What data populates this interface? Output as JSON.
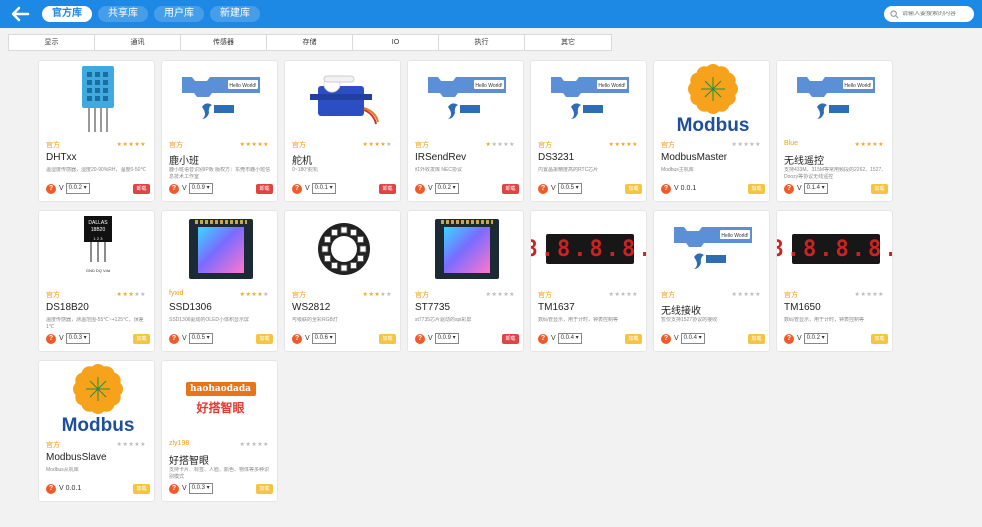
{
  "header": {
    "tabs": [
      "官方库",
      "共享库",
      "用户库",
      "新建库"
    ],
    "search_placeholder": "请输入要搜索的内容"
  },
  "categories": [
    "显示",
    "通讯",
    "传感器",
    "存储",
    "IO",
    "执行",
    "其它"
  ],
  "colors": {
    "accent": "#1e88e5",
    "author": "#f39c12",
    "star": "#f5a623",
    "help": "#f05a28",
    "btn_red": "#e04444",
    "btn_yellow": "#f5c542"
  },
  "libraries": [
    {
      "name": "DHTxx",
      "author": "官方",
      "rating": 5,
      "desc": "温湿度传感器，湿度20-90%RH，温度0-50℃",
      "version_label": "V",
      "version": "0.0.2 ▾",
      "action": "卸载",
      "action_style": "red",
      "image": "dht11-sensor"
    },
    {
      "name": "鹿小班",
      "author": "官方",
      "rating": 5,
      "desc": "鹿小班语音识别IP板 版权方：东莞市鹿小班信息技术工作室",
      "version_label": "V",
      "version": "0.0.9 ▾",
      "action": "卸载",
      "action_style": "red",
      "image": "hello-world-block"
    },
    {
      "name": "舵机",
      "author": "官方",
      "rating": 4,
      "desc": "0~180°舵机",
      "version_label": "V",
      "version": "0.0.1 ▾",
      "action": "卸载",
      "action_style": "red",
      "image": "servo-motor"
    },
    {
      "name": "IRSendRev",
      "author": "官方",
      "rating": 1,
      "desc": "红外收发库 NEC协议",
      "version_label": "V",
      "version": "0.0.2 ▾",
      "action": "卸载",
      "action_style": "red",
      "image": "hello-world-block"
    },
    {
      "name": "DS3231",
      "author": "官方",
      "rating": 5,
      "desc": "内置晶振精度高的RTC芯片",
      "version_label": "V",
      "version": "0.0.5 ▾",
      "action": "加载",
      "action_style": "yellow",
      "image": "hello-world-block"
    },
    {
      "name": "ModbusMaster",
      "author": "官方",
      "rating": 0,
      "desc": "Modbus主机库",
      "version_label": "V",
      "version": "0.0.1",
      "action": "加载",
      "action_style": "yellow",
      "image": "modbus-logo"
    },
    {
      "name": "无线遥控",
      "author": "Blue",
      "rating": 5,
      "desc": "支持433M、315M等常用频段的2262、1527、Doozy等协议无线遥控",
      "version_label": "V",
      "version": "0.1.4 ▾",
      "action": "加载",
      "action_style": "yellow",
      "image": "hello-world-block"
    },
    {
      "name": "DS18B20",
      "author": "官方",
      "rating": 3,
      "desc": "温度传感器，测温范围-55℃~+125℃，误差1℃",
      "version_label": "V",
      "version": "0.0.3 ▾",
      "action": "加载",
      "action_style": "yellow",
      "image": "ds18b20-chip"
    },
    {
      "name": "SSD1306",
      "author": "fyxid",
      "rating": 4,
      "desc": "SSD1306驱动的OLED小体积显示屏",
      "version_label": "V",
      "version": "0.0.5 ▾",
      "action": "加载",
      "action_style": "yellow",
      "image": "tft-display"
    },
    {
      "name": "WS2812",
      "author": "官方",
      "rating": 3,
      "desc": "可级联的全彩RGB灯",
      "version_label": "V",
      "version": "0.0.6 ▾",
      "action": "加载",
      "action_style": "yellow",
      "image": "ws2812-ring"
    },
    {
      "name": "ST7735",
      "author": "官方",
      "rating": 0,
      "desc": "st7735芯片驱动的spi彩屏",
      "version_label": "V",
      "version": "0.0.9 ▾",
      "action": "卸载",
      "action_style": "red",
      "image": "tft-display"
    },
    {
      "name": "TM1637",
      "author": "官方",
      "rating": 0,
      "desc": "数码管显示，用于计时，钟表控制等",
      "version_label": "V",
      "version": "0.0.4 ▾",
      "action": "加载",
      "action_style": "yellow",
      "image": "seven-segment"
    },
    {
      "name": "无线接收",
      "author": "官方",
      "rating": 0,
      "desc": "暂仅支持1527协议的接收",
      "version_label": "V",
      "version": "0.0.4 ▾",
      "action": "加载",
      "action_style": "yellow",
      "image": "hello-world-block"
    },
    {
      "name": "TM1650",
      "author": "官方",
      "rating": 0,
      "desc": "数码管显示，用于计时，钟表控制等",
      "version_label": "V",
      "version": "0.0.2 ▾",
      "action": "加载",
      "action_style": "yellow",
      "image": "seven-segment"
    },
    {
      "name": "ModbusSlave",
      "author": "官方",
      "rating": 0,
      "desc": "Modbus从机库",
      "version_label": "V",
      "version": "0.0.1",
      "action": "加载",
      "action_style": "yellow",
      "image": "modbus-logo"
    },
    {
      "name": "好搭智眼",
      "author": "zly198",
      "rating": 0,
      "desc": "支持卡片、标签、人脸、颜色、物体等多种识别模式",
      "version_label": "V",
      "version": "0.0.3 ▾",
      "action": "加载",
      "action_style": "yellow",
      "image": "haohaodada-logo"
    }
  ],
  "image_text": {
    "hello_world": "Hello World!",
    "modbus": "Modbus",
    "ds18b20_line1": "DALLAS",
    "ds18b20_line2": "18B20",
    "ds18b20_pins": "1 2 3",
    "ds18b20_legs": "GND DQ Vdd",
    "seven_segment": "8.8.8.8.",
    "haohao_top": "haohaodada",
    "haohao_bottom": "好搭智眼"
  }
}
